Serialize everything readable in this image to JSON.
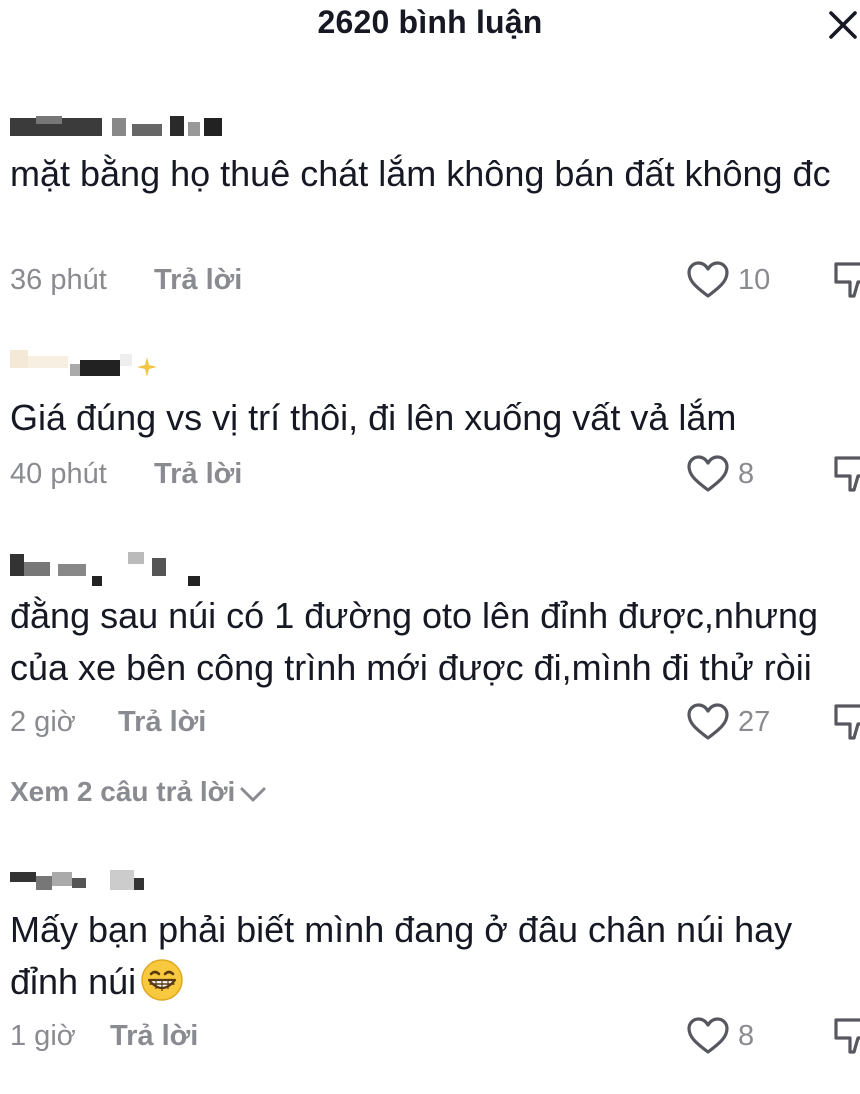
{
  "header": {
    "title": "2620 bình luận"
  },
  "comments": [
    {
      "text": "mặt bằng họ thuê chát lắm không bán đất không đc",
      "time": "36 phút",
      "reply_label": "Trả lời",
      "likes": "10"
    },
    {
      "text": "Giá đúng vs vị trí thôi, đi lên xuống vất vả lắm",
      "time": "40 phút",
      "reply_label": "Trả lời",
      "likes": "8"
    },
    {
      "text": "đằng sau núi có 1 đường oto lên đỉnh được,nhưng của xe bên công trình mới được đi,mình đi thử ròii",
      "time": "2 giờ",
      "reply_label": "Trả lời",
      "likes": "27",
      "view_replies": "Xem 2 câu trả lời"
    },
    {
      "text": "Mấy bạn phải biết mình đang ở đâu chân núi hay đỉnh núi",
      "time": "1 giờ",
      "reply_label": "Trả lời",
      "likes": "8"
    }
  ]
}
